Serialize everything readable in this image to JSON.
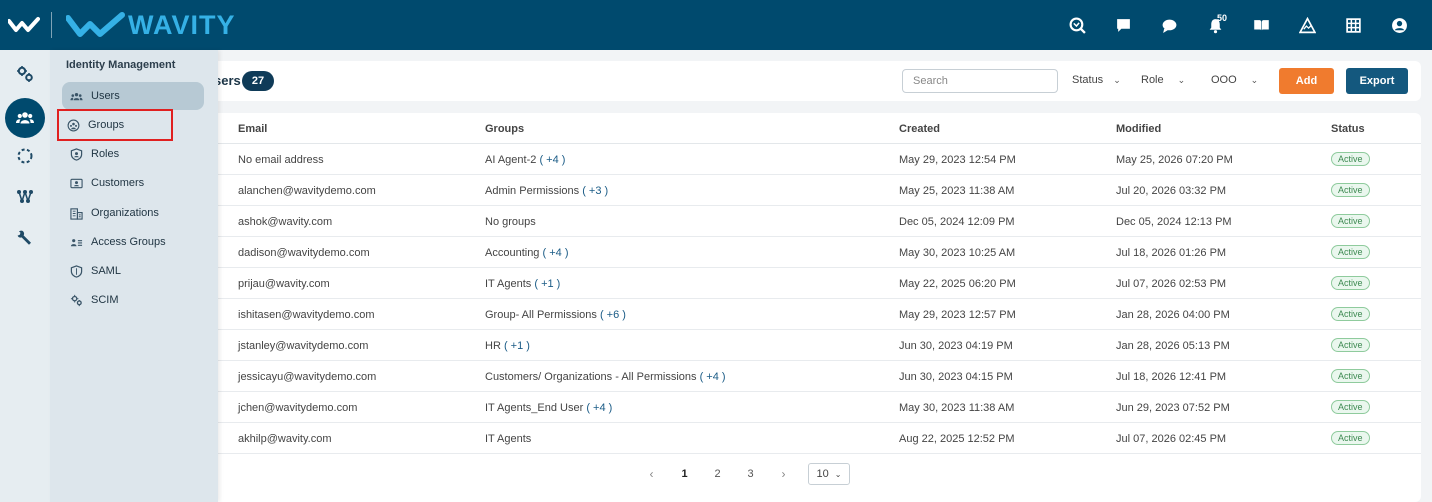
{
  "brand": {
    "name": "WAVITY"
  },
  "header": {
    "icons": [
      "search-globe-icon",
      "chat-square-icon",
      "chat-bubble-icon",
      "bell-icon",
      "book-icon",
      "triangle-logo-icon",
      "grid-icon",
      "user-account-icon"
    ],
    "notification_count": "50"
  },
  "rail": {
    "items": [
      "settings-gears-icon",
      "users-group-icon",
      "loading-circle-icon",
      "workflow-icon",
      "wrench-icon"
    ],
    "active_index": 1
  },
  "flyout": {
    "title": "Identity Management",
    "items": [
      {
        "label": "Users",
        "icon": "users-icon"
      },
      {
        "label": "Groups",
        "icon": "groups-icon"
      },
      {
        "label": "Roles",
        "icon": "roles-icon"
      },
      {
        "label": "Customers",
        "icon": "customers-icon"
      },
      {
        "label": "Organizations",
        "icon": "organizations-icon"
      },
      {
        "label": "Access Groups",
        "icon": "access-groups-icon"
      },
      {
        "label": "SAML",
        "icon": "shield-icon"
      },
      {
        "label": "SCIM",
        "icon": "gears-icon"
      }
    ]
  },
  "toolbar": {
    "title": "sers",
    "count": "27",
    "search_placeholder": "Search",
    "filters": [
      "Status",
      "Role",
      "OOO"
    ],
    "add_label": "Add",
    "export_label": "Export"
  },
  "table": {
    "headers": [
      "Email",
      "Groups",
      "Created",
      "Modified",
      "Status"
    ],
    "rows": [
      {
        "email": "No email address",
        "group": "AI Agent-2",
        "more": "( +4 )",
        "created": "May 29, 2023 12:54 PM",
        "modified": "May 25, 2026 07:20 PM",
        "status": "Active"
      },
      {
        "email": "alanchen@wavitydemo.com",
        "group": "Admin Permissions",
        "more": "( +3 )",
        "created": "May 25, 2023 11:38 AM",
        "modified": "Jul 20, 2026 03:32 PM",
        "status": "Active"
      },
      {
        "email": "ashok@wavity.com",
        "group": "No groups",
        "more": "",
        "created": "Dec 05, 2024 12:09 PM",
        "modified": "Dec 05, 2024 12:13 PM",
        "status": "Active"
      },
      {
        "email": "dadison@wavitydemo.com",
        "group": "Accounting",
        "more": "( +4 )",
        "created": "May 30, 2023 10:25 AM",
        "modified": "Jul 18, 2026 01:26 PM",
        "status": "Active"
      },
      {
        "email": "prijau@wavity.com",
        "group": "IT Agents",
        "more": "( +1 )",
        "created": "May 22, 2025 06:20 PM",
        "modified": "Jul 07, 2026 02:53 PM",
        "status": "Active"
      },
      {
        "email": "ishitasen@wavitydemo.com",
        "group": "Group- All Permissions",
        "more": "( +6 )",
        "created": "May 29, 2023 12:57 PM",
        "modified": "Jan 28, 2026 04:00 PM",
        "status": "Active"
      },
      {
        "email": "jstanley@wavitydemo.com",
        "group": "HR",
        "more": "( +1 )",
        "created": "Jun 30, 2023 04:19 PM",
        "modified": "Jan 28, 2026 05:13 PM",
        "status": "Active"
      },
      {
        "email": "jessicayu@wavitydemo.com",
        "group": "Customers/ Organizations - All Permissions",
        "more": "( +4 )",
        "created": "Jun 30, 2023 04:15 PM",
        "modified": "Jul 18, 2026 12:41 PM",
        "status": "Active"
      },
      {
        "email": "jchen@wavitydemo.com",
        "group": "IT Agents_End User",
        "more": "( +4 )",
        "created": "May 30, 2023 11:38 AM",
        "modified": "Jun 29, 2023 07:52 PM",
        "status": "Active"
      },
      {
        "email": "akhilp@wavity.com",
        "group": "IT Agents",
        "more": "",
        "created": "Aug 22, 2025 12:52 PM",
        "modified": "Jul 07, 2026 02:45 PM",
        "status": "Active"
      }
    ]
  },
  "pagination": {
    "pages": [
      "1",
      "2",
      "3"
    ],
    "current": "1",
    "prev": "‹",
    "next": "›",
    "page_size": "10"
  }
}
